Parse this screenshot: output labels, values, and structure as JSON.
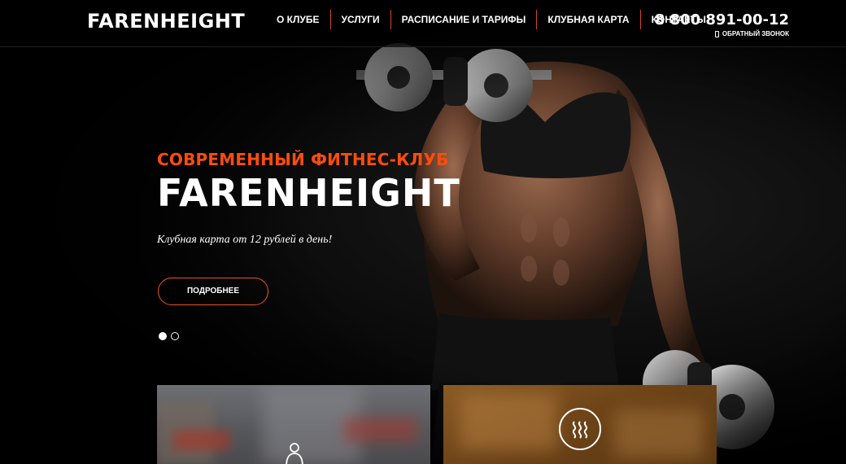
{
  "header": {
    "logo": "FARENHEIGHT",
    "nav": [
      {
        "label": "О КЛУБЕ"
      },
      {
        "label": "УСЛУГИ"
      },
      {
        "label": "РАСПИСАНИЕ И ТАРИФЫ"
      },
      {
        "label": "КЛУБНАЯ КАРТА"
      },
      {
        "label": "КОНТАКТЫ"
      }
    ],
    "phone": "8 800 891-00-12",
    "callback_label": "ОБРАТНЫЙ ЗВОНОК",
    "callback_icon": "phone-icon"
  },
  "hero": {
    "subtitle": "СОВРЕМЕННЫЙ ФИТНЕС-КЛУБ",
    "title": "FARENHEIGHT",
    "tagline": "Клубная карта от 12 рублей в день!",
    "button_label": "ПОДРОБНЕЕ",
    "slides_total": 2,
    "slide_active": 1
  },
  "cards": [
    {
      "icon": "person-icon"
    },
    {
      "icon": "steam-heat-icon"
    }
  ],
  "colors": {
    "accent": "#ff4c0c",
    "button_border": "#e8561c",
    "nav_separator": "#d04a12",
    "background": "#000000"
  }
}
